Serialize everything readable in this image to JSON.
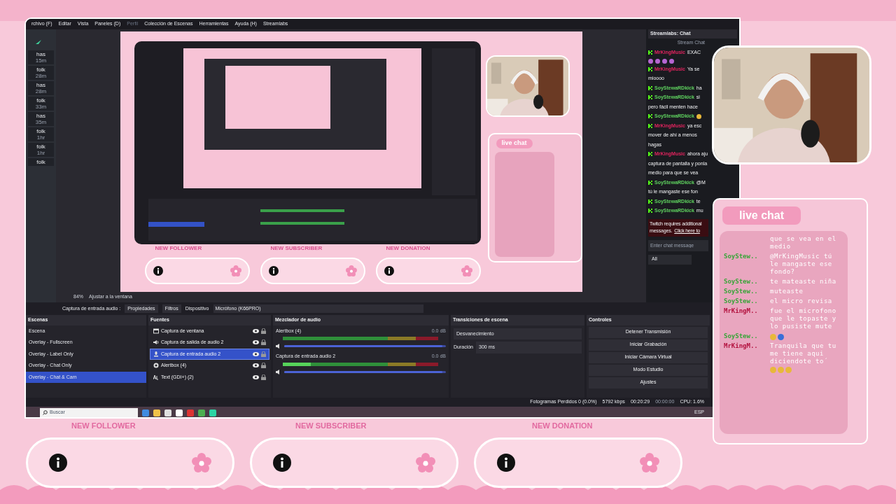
{
  "menu": [
    {
      "label": "rchivo (F)",
      "disabled": false
    },
    {
      "label": "Editar",
      "disabled": false
    },
    {
      "label": "Vista",
      "disabled": false
    },
    {
      "label": "Paneles (D)",
      "disabled": false
    },
    {
      "label": "Perfil",
      "disabled": true
    },
    {
      "label": "Colección de Escenas",
      "disabled": false
    },
    {
      "label": "Herramientas",
      "disabled": false
    },
    {
      "label": "Ayuda (H)",
      "disabled": false
    },
    {
      "label": "Streamlabs",
      "disabled": false
    }
  ],
  "activity_feed": [
    {
      "name": "has",
      "time": "15m"
    },
    {
      "name": "folk",
      "time": "28m"
    },
    {
      "name": "has",
      "time": "28m"
    },
    {
      "name": "folk",
      "time": "33m"
    },
    {
      "name": "has",
      "time": "35m"
    },
    {
      "name": "folk",
      "time": "1hr"
    },
    {
      "name": "folk",
      "time": "1hr"
    },
    {
      "name": "folk"
    }
  ],
  "preview": {
    "alert_labels": [
      "NEW FOLLOWER",
      "NEW SUBSCRIBER",
      "NEW DONATION"
    ],
    "chat_title": "live chat",
    "zoom": "84%",
    "fit": "Ajustar a la ventana"
  },
  "chat_dock": {
    "title": "Streamlabs: Chat",
    "subtitle": "Stream Chat",
    "messages": [
      {
        "user": "MrKingMusic",
        "color": "#e0245e",
        "lines": [
          "EXAC"
        ],
        "emoji": [
          {
            "color": "#b666d2"
          },
          {
            "color": "#b666d2"
          },
          {
            "color": "#b666d2"
          },
          {
            "color": "#b666d2"
          }
        ]
      },
      {
        "user": "MrKingMusic",
        "color": "#e0245e",
        "lines": [
          "Ya se",
          "mioooo"
        ]
      },
      {
        "user": "SoyStewaRDkick",
        "color": "#5fd35f",
        "lines": [
          "ha"
        ]
      },
      {
        "user": "SoyStewaRDkick",
        "color": "#5fd35f",
        "lines": [
          "si",
          "pero fácil menten hace"
        ]
      },
      {
        "user": "SoyStewaRDkick",
        "color": "#5fd35f",
        "emoji": [
          {
            "color": "#e8b83a"
          }
        ]
      },
      {
        "user": "MrKingMusic",
        "color": "#e0245e",
        "lines": [
          "ya esc",
          "mover de ahí a menos",
          "hagas"
        ]
      },
      {
        "user": "MrKingMusic",
        "color": "#e0245e",
        "lines": [
          "ahora aju",
          "captura de pantalla y ponla",
          "medio para que se vea"
        ]
      },
      {
        "user": "SoyStewaRDkick",
        "color": "#5fd35f",
        "lines": [
          "@M",
          "tú le mangaste ese fon"
        ]
      },
      {
        "user": "SoyStewaRDkick",
        "color": "#5fd35f",
        "lines": [
          "te"
        ]
      },
      {
        "user": "SoyStewaRDkick",
        "color": "#5fd35f",
        "lines": [
          "mu"
        ]
      }
    ],
    "notice": [
      "Twitch requires additional",
      "messages."
    ],
    "notice_link": "Click here to",
    "input_placeholder": "Enter chat message",
    "filter": "All"
  },
  "source_toolbar": {
    "source": "Captura de entrada audio :",
    "properties": "Propiedades",
    "filters": "Filtros",
    "device_label": "Dispositivo",
    "device": "Micrófono (K66PRO)"
  },
  "scenes": {
    "title": "Escenas",
    "items": [
      {
        "label": "Escena",
        "selected": false
      },
      {
        "label": "Overlay - Fullscreen",
        "selected": false
      },
      {
        "label": "Overlay - Label Only",
        "selected": false
      },
      {
        "label": "Overlay - Chat Only",
        "selected": false
      },
      {
        "label": "Overlay - Chat & Cam",
        "selected": true
      }
    ]
  },
  "sources": {
    "title": "Fuentes",
    "items": [
      {
        "label": "Captura de ventana",
        "kind": "window",
        "selected": false,
        "visible": true,
        "locked": true
      },
      {
        "label": "Captura de salida de audio 2",
        "kind": "speaker",
        "selected": false,
        "visible": true,
        "locked": true
      },
      {
        "label": "Captura de entrada audio 2",
        "kind": "mic",
        "selected": true,
        "visible": true,
        "locked": true
      },
      {
        "label": "Alertbox (4)",
        "kind": "browser",
        "selected": false,
        "visible": true,
        "locked": true
      },
      {
        "label": "Text (GDI+) (2)",
        "kind": "text",
        "selected": false,
        "visible": true,
        "locked": true
      }
    ]
  },
  "mixer": {
    "title": "Mezclador de audio",
    "channels": [
      {
        "name": "Alertbox (4)",
        "reading": "0.0 dB",
        "level": 0.98
      },
      {
        "name": "Captura de entrada audio 2",
        "reading": "0.0 dB",
        "level": 0.98
      }
    ]
  },
  "transitions": {
    "title": "Transiciones de escena",
    "transition": "Desvanecimiento",
    "duration_label": "Duración",
    "duration": "300 ms"
  },
  "controls": {
    "title": "Controles",
    "buttons": [
      "Detener Transmisión",
      "Iniciar Grabación",
      "Iniciar Cámara Virtual",
      "Modo Estudio",
      "Ajustes"
    ]
  },
  "status_bar": {
    "dropped": "Fotogramas Perdidos 0 (0.0%)",
    "bitrate": "5792 kbps",
    "live_time": "00:20:29",
    "rec_time": "00:00:00",
    "cpu": "CPU: 1.6%"
  },
  "taskbar": {
    "search_placeholder": "Buscar",
    "language": "ESP"
  },
  "live_chat": {
    "title": "live chat",
    "messages": [
      {
        "text": "que se vea en el medio"
      },
      {
        "user": "SoyStew..",
        "color": "#3aa53a",
        "text": "@MrKingMusic tú le mangaste ese fondo?"
      },
      {
        "user": "SoyStew..",
        "color": "#3aa53a",
        "text": "te mateaste niña"
      },
      {
        "user": "SoyStew..",
        "color": "#3aa53a",
        "text": "muteaste"
      },
      {
        "user": "SoyStew..",
        "color": "#3aa53a",
        "text": "el micro revisa"
      },
      {
        "user": "MrKingM..",
        "color": "#b3123f",
        "text": "fue el microfono que le topaste y lo pusiste mute"
      },
      {
        "user": "SoyStew..",
        "color": "#3aa53a",
        "emoji": [
          {
            "color": "#e8b83a"
          },
          {
            "color": "#3a6fd8"
          }
        ]
      },
      {
        "user": "MrKingM..",
        "color": "#b3123f",
        "text": "Tranquila que tu me tiene aqui diciendote to´",
        "emoji": [
          {
            "color": "#e8b83a"
          },
          {
            "color": "#e8b83a"
          },
          {
            "color": "#e8b83a"
          }
        ]
      }
    ]
  },
  "alerts": [
    "NEW FOLLOWER",
    "NEW SUBSCRIBER",
    "NEW DONATION"
  ]
}
